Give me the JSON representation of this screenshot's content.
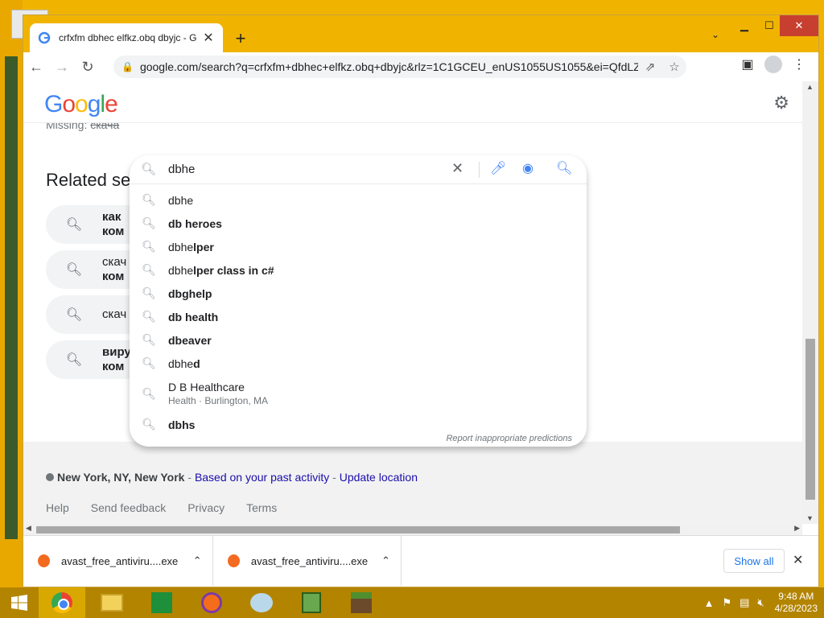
{
  "browser": {
    "tab_title": "crfxfm dbhec elfkz.obq dbyjc - G",
    "url": "google.com/search?q=crfxfm+dbhec+elfkz.obq+dbyjc&rlz=1C1GCEU_enUS1055US1055&ei=QfdLZlmxJa..."
  },
  "google": {
    "logo": "Google",
    "query": "dbhe",
    "missing_label": "Missing:",
    "missing_struck": "скача"
  },
  "suggestions": [
    {
      "typed": "dbhe",
      "rest": ""
    },
    {
      "typed": "",
      "rest": "db heroes"
    },
    {
      "typed": "dbhe",
      "rest": "lper"
    },
    {
      "typed": "dbhe",
      "rest": "lper class in c#"
    },
    {
      "typed": "",
      "rest": "dbghelp"
    },
    {
      "typed": "",
      "rest": "db health"
    },
    {
      "typed": "",
      "rest": "dbeaver"
    },
    {
      "typed": "dbhe",
      "rest": "d"
    },
    {
      "typed": "D B Healthcare",
      "rest": "",
      "sub": "Health · Burlington, MA"
    },
    {
      "typed": "",
      "rest": "dbhs"
    }
  ],
  "report_text": "Report inappropriate predictions",
  "related": {
    "title": "Related sea",
    "items": [
      {
        "line1": "как",
        "line2": "ком",
        "bold1": true
      },
      {
        "line1": "скач",
        "line2": "ком",
        "bold1": false
      },
      {
        "line1": "скач",
        "line2": "",
        "bold1": false
      },
      {
        "line1": "виру",
        "line2": "ком",
        "bold1": true
      }
    ]
  },
  "footer": {
    "location": "New York, NY, New York",
    "sep1": " - ",
    "based": "Based on your past activity",
    "sep2": " - ",
    "update": "Update location",
    "links": [
      "Help",
      "Send feedback",
      "Privacy",
      "Terms"
    ]
  },
  "downloads": {
    "items": [
      "avast_free_antiviru....exe",
      "avast_free_antiviru....exe"
    ],
    "show_all": "Show all"
  },
  "taskbar": {
    "time": "9:48 AM",
    "date": "4/28/2023"
  }
}
